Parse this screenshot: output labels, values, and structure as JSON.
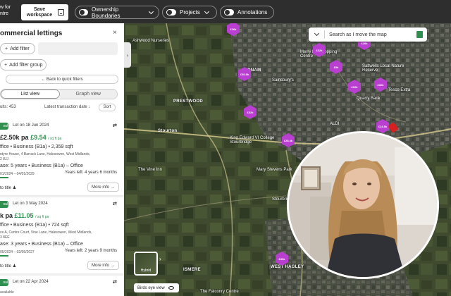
{
  "header": {
    "brand_line1": "w for",
    "brand_line2": "ntre",
    "save_label": "Save workspace",
    "toggles": [
      {
        "label": "Ownership Boundaries"
      },
      {
        "label": "Projects"
      },
      {
        "label": "Annotations"
      }
    ]
  },
  "panel": {
    "title": "ommercial lettings",
    "close": "×",
    "add_filter": "Add filter",
    "add_filter_group": "Add filter group",
    "quick_filters": "Back to quick filters",
    "tabs": [
      {
        "label": "List view"
      },
      {
        "label": "Graph view"
      }
    ],
    "results": "ults: 453",
    "sort_by": "Latest transaction date ↓",
    "sort_button": "Sort",
    "cards": [
      {
        "badge": "oal",
        "let_date": "Let on 18 Jun 2024",
        "rent": "2.50k pa",
        "per_sqft": "£9.54",
        "per_sqft_unit": "/ sq ft pa",
        "use_line": "ffice  •  Business (B1a)  •  2,359 sqft",
        "address": "ntyre House, 4 Barrack Lane, Halesowen, West Midlands,",
        "postcode": "2 8JJ",
        "lease": "ase: 5 years  •  Business (B1a) – Office",
        "dates": "01/2024 – 04/01/2029",
        "years_left": "Years left: 4 years 6 months",
        "progress": 0.1,
        "go_title": "to title",
        "more_info": "More info"
      },
      {
        "badge": "oal",
        "let_date": "Let on 3 May 2024",
        "rent": "k pa",
        "per_sqft": "£11.05",
        "per_sqft_unit": "/ sq ft pa",
        "use_line": "ffice  •  Business (B1a)  •  724 sqft",
        "address": "ce A, Centre Court, Vine Lane, Halesowen, West Midlands,",
        "postcode": "3 8EE",
        "lease": "ase: 3 years  •  Business (B1a) – Office",
        "dates": "05/2024 – 02/05/2027",
        "years_left": "Years left: 2 years 9 months",
        "progress": 0.1,
        "go_title": "to title",
        "more_info": "More info"
      },
      {
        "badge": "oal",
        "let_date": "Let on 22 Apr 2024",
        "available": "available"
      }
    ]
  },
  "map": {
    "search_placeholder": "Search as I move the map",
    "hybrid_label": "Hybrid",
    "birds_eye_label": "Birds eye view",
    "accent_color": "#b83fcf",
    "places": [
      {
        "name": "Ashwood Nurseries"
      },
      {
        "name": "AUDNAM"
      },
      {
        "name": "Sainsbury's"
      },
      {
        "name": "Stourton"
      },
      {
        "name": "King Edward VI College Stourbridge"
      },
      {
        "name": "The Vine Inn"
      },
      {
        "name": "Mary Stevens Park"
      },
      {
        "name": "Stourbridge Golf Club"
      },
      {
        "name": "Quarry Bank"
      },
      {
        "name": "ALDI"
      },
      {
        "name": "Tesco Extra"
      },
      {
        "name": "Merry Hill Shopping Centre"
      },
      {
        "name": "ISMERE"
      },
      {
        "name": "WEST HAGLEY"
      },
      {
        "name": "The Falconry Centre"
      },
      {
        "name": "Saltwells Local Nature Reserve"
      },
      {
        "name": "PRESTWOOD"
      }
    ],
    "markers": [
      {
        "label": "£26k"
      },
      {
        "label": "£36.8k"
      },
      {
        "label": "£32k"
      },
      {
        "label": "£28.4k"
      },
      {
        "label": "£9k"
      },
      {
        "label": "£22k"
      },
      {
        "label": "£32k"
      },
      {
        "label": "£24.5k"
      },
      {
        "label": "£32k"
      },
      {
        "label": "£29k"
      },
      {
        "label": "£33k"
      }
    ]
  }
}
